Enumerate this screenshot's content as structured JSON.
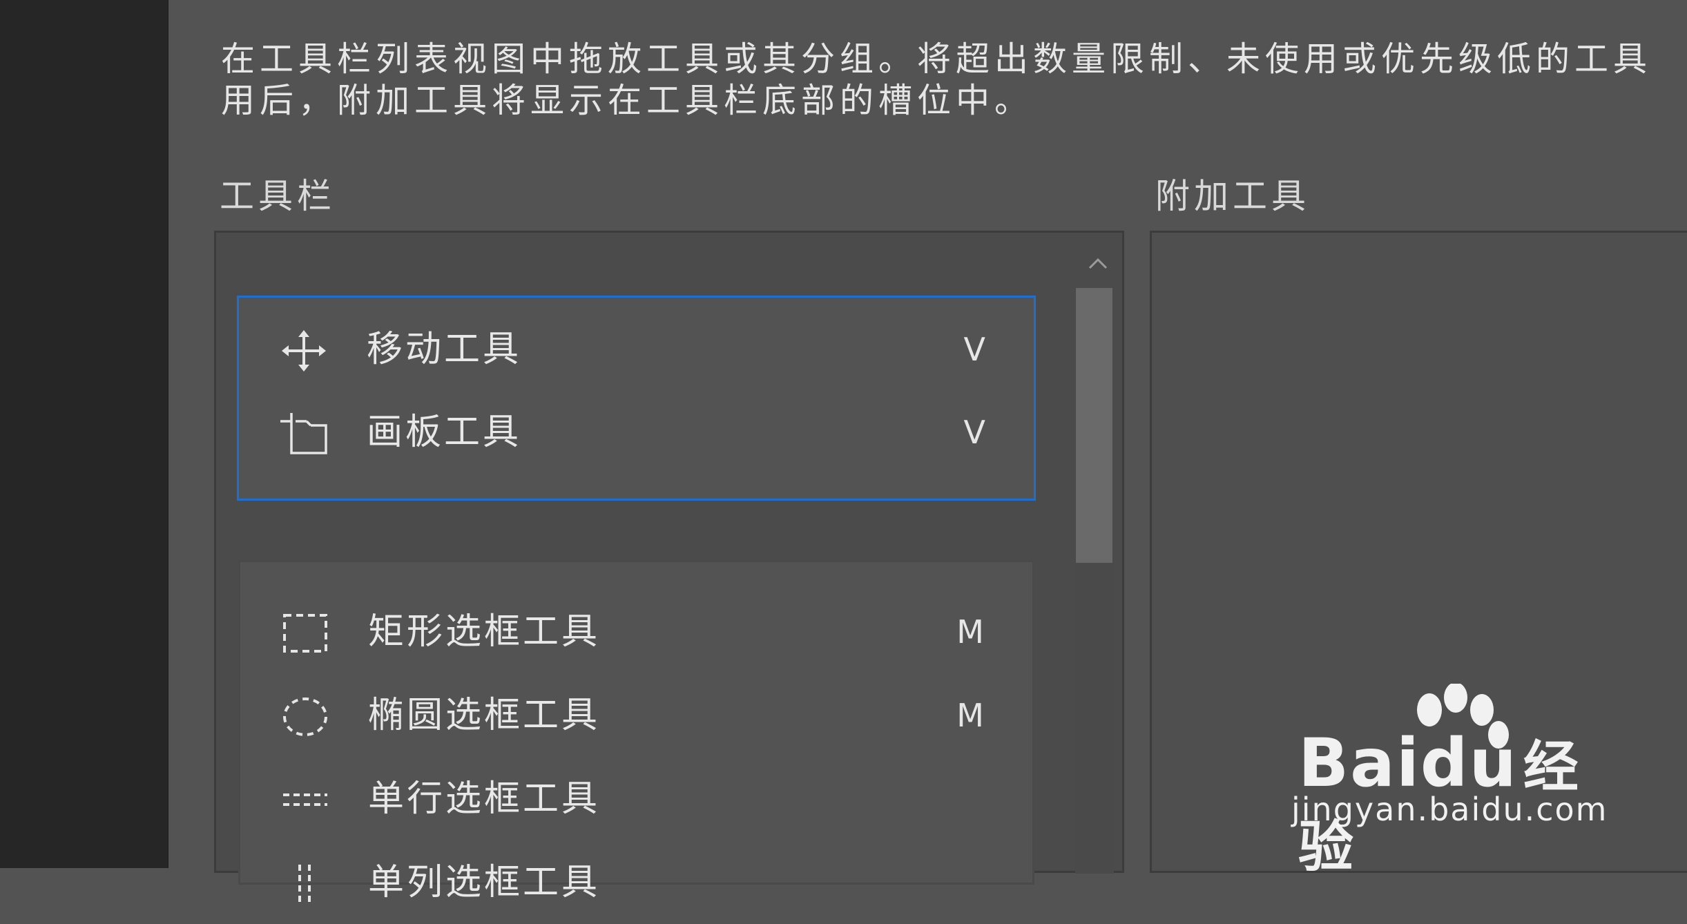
{
  "description": {
    "line1": "在工具栏列表视图中拖放工具或其分组。将超出数量限制、未使用或优先级低的工具",
    "line2": "用后，附加工具将显示在工具栏底部的槽位中。"
  },
  "toolbar_label": "工具栏",
  "extra_tools_label": "附加工具",
  "scroll": {
    "up_icon": "chevron-up-icon",
    "up_glyph": "⌃"
  },
  "groups": [
    {
      "selected": true,
      "tools": [
        {
          "label": "移动工具",
          "key": "V",
          "icon": "move-icon"
        },
        {
          "label": "画板工具",
          "key": "V",
          "icon": "artboard-icon"
        }
      ]
    },
    {
      "selected": false,
      "tools": [
        {
          "label": "矩形选框工具",
          "key": "M",
          "icon": "rect-marquee-icon"
        },
        {
          "label": "椭圆选框工具",
          "key": "M",
          "icon": "ellipse-marquee-icon"
        },
        {
          "label": "单行选框工具",
          "key": "",
          "icon": "single-row-marquee-icon"
        },
        {
          "label": "单列选框工具",
          "key": "",
          "icon": "single-column-marquee-icon"
        }
      ]
    }
  ],
  "watermark": {
    "brand_a": "Bai",
    "brand_b": "du",
    "brand_c": "经验",
    "site": "jingyan.baidu.com"
  },
  "colors": {
    "selection_border": "#1f6fd1",
    "background": "#535353",
    "dark_strip": "#262626"
  }
}
